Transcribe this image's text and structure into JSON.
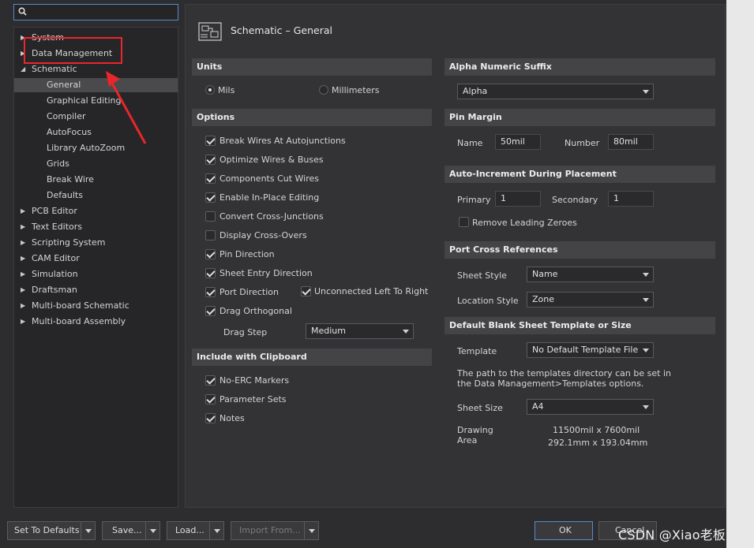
{
  "window": {
    "title": "Schematic – General"
  },
  "search": {
    "placeholder": ""
  },
  "tree": {
    "items": [
      {
        "label": "System",
        "level": 0,
        "arrow": "collapsed"
      },
      {
        "label": "Data Management",
        "level": 0,
        "arrow": "collapsed"
      },
      {
        "label": "Schematic",
        "level": 0,
        "arrow": "expanded"
      },
      {
        "label": "General",
        "level": 1,
        "arrow": "none",
        "selected": true
      },
      {
        "label": "Graphical Editing",
        "level": 1,
        "arrow": "none"
      },
      {
        "label": "Compiler",
        "level": 1,
        "arrow": "none"
      },
      {
        "label": "AutoFocus",
        "level": 1,
        "arrow": "none"
      },
      {
        "label": "Library AutoZoom",
        "level": 1,
        "arrow": "none"
      },
      {
        "label": "Grids",
        "level": 1,
        "arrow": "none"
      },
      {
        "label": "Break Wire",
        "level": 1,
        "arrow": "none"
      },
      {
        "label": "Defaults",
        "level": 1,
        "arrow": "none"
      },
      {
        "label": "PCB Editor",
        "level": 0,
        "arrow": "collapsed"
      },
      {
        "label": "Text Editors",
        "level": 0,
        "arrow": "collapsed"
      },
      {
        "label": "Scripting System",
        "level": 0,
        "arrow": "collapsed"
      },
      {
        "label": "CAM Editor",
        "level": 0,
        "arrow": "collapsed"
      },
      {
        "label": "Simulation",
        "level": 0,
        "arrow": "collapsed"
      },
      {
        "label": "Draftsman",
        "level": 0,
        "arrow": "collapsed"
      },
      {
        "label": "Multi-board Schematic",
        "level": 0,
        "arrow": "collapsed"
      },
      {
        "label": "Multi-board Assembly",
        "level": 0,
        "arrow": "collapsed"
      }
    ]
  },
  "units": {
    "header": "Units",
    "mils": "Mils",
    "millimeters": "Millimeters",
    "selected": "Mils"
  },
  "options": {
    "header": "Options",
    "items": [
      {
        "label": "Break Wires At Autojunctions",
        "checked": true
      },
      {
        "label": "Optimize Wires & Buses",
        "checked": true
      },
      {
        "label": "Components Cut Wires",
        "checked": true
      },
      {
        "label": "Enable In-Place Editing",
        "checked": true
      },
      {
        "label": "Convert Cross-Junctions",
        "checked": false
      },
      {
        "label": "Display Cross-Overs",
        "checked": false
      },
      {
        "label": "Pin Direction",
        "checked": true
      },
      {
        "label": "Sheet Entry Direction",
        "checked": true
      },
      {
        "label": "Port Direction",
        "checked": true
      },
      {
        "label": "Drag Orthogonal",
        "checked": true
      }
    ],
    "unconnected_label": "Unconnected Left To Right",
    "unconnected_checked": true,
    "drag_step_label": "Drag Step",
    "drag_step_value": "Medium"
  },
  "clipboard": {
    "header": "Include with Clipboard",
    "items": [
      {
        "label": "No-ERC Markers",
        "checked": true
      },
      {
        "label": "Parameter Sets",
        "checked": true
      },
      {
        "label": "Notes",
        "checked": true
      }
    ]
  },
  "alpha": {
    "header": "Alpha Numeric Suffix",
    "value": "Alpha"
  },
  "pin_margin": {
    "header": "Pin Margin",
    "name_label": "Name",
    "name_value": "50mil",
    "number_label": "Number",
    "number_value": "80mil"
  },
  "auto_increment": {
    "header": "Auto-Increment During Placement",
    "primary_label": "Primary",
    "primary_value": "1",
    "secondary_label": "Secondary",
    "secondary_value": "1",
    "remove_zeroes_label": "Remove Leading Zeroes",
    "remove_zeroes_checked": false
  },
  "port_cross": {
    "header": "Port Cross References",
    "sheet_style_label": "Sheet Style",
    "sheet_style_value": "Name",
    "location_style_label": "Location Style",
    "location_style_value": "Zone"
  },
  "template": {
    "header": "Default Blank Sheet Template or Size",
    "template_label": "Template",
    "template_value": "No Default Template File",
    "path_note_line1": "The path to the templates directory can be set in",
    "path_note_line2": "the Data Management>Templates options.",
    "sheet_size_label": "Sheet Size",
    "sheet_size_value": "A4",
    "drawing_area_label_1": "Drawing",
    "drawing_area_label_2": "Area",
    "drawing_area_mil": "11500mil x 7600mil",
    "drawing_area_mm": "292.1mm x 193.04mm"
  },
  "buttons": {
    "set_defaults": "Set To Defaults",
    "save": "Save...",
    "load": "Load...",
    "import_from": "Import From...",
    "ok": "OK",
    "cancel": "Cancel"
  },
  "watermark": "CSDN @Xiao老板",
  "colors": {
    "accent": "#5a8ac8",
    "annotation_red": "#e8262b",
    "background": "#2d2d30"
  }
}
